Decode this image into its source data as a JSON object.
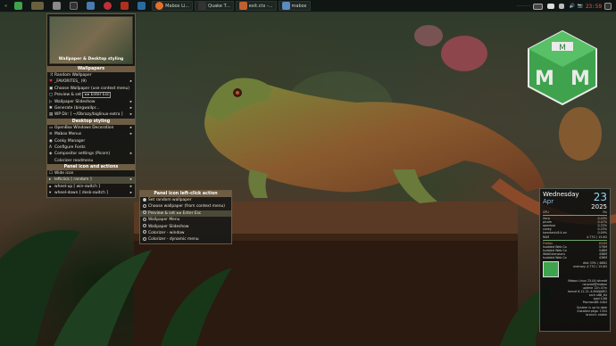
{
  "panel": {
    "tasks": [
      "Mabox Li...",
      "Quake T...",
      "exit.ctx -...",
      "mabox"
    ],
    "clock": "23:59"
  },
  "menu": {
    "thumb_caption": "Wallpaper & Desktop styling",
    "sections": {
      "wallpapers": "Wallpapers",
      "desktop": "Desktop styling",
      "panel_icon": "Panel icon and actions"
    },
    "items": [
      {
        "label": "Random Wallpaper",
        "arrow": ""
      },
      {
        "label": "_FAVORITES_",
        "extra": "(9)",
        "arrow": "▸"
      },
      {
        "label": "Choose Wallpaper (use context menu)",
        "arrow": ""
      },
      {
        "label": "Preview & set",
        "extra": "◂ ▸ Enter Esc",
        "arrow": ""
      },
      {
        "label": "Wallpaper Slideshow",
        "arrow": "▸"
      },
      {
        "label": "Generate (bingwallpr...",
        "arrow": "▸"
      },
      {
        "label": "WP Dir: [ ~/Obrazy/biglinux-extra ]",
        "arrow": "▸"
      }
    ],
    "desktop_items": [
      {
        "label": "OpenBox Windows Decoration",
        "arrow": "▸"
      },
      {
        "label": "Mabox Menus",
        "arrow": "▸"
      },
      {
        "label": "Conky Manager",
        "arrow": ""
      },
      {
        "label": "Configure Fonts",
        "arrow": ""
      },
      {
        "label": "Compositor settings (Picom)",
        "arrow": "▸"
      },
      {
        "label": "Colorizer readmenu",
        "arrow": ""
      }
    ],
    "panel_items": [
      {
        "label": "Wide icon",
        "arrow": ""
      },
      {
        "label": "leftclick [ random ]",
        "arrow": "▸"
      },
      {
        "label": "wheel-up [ win-switch ]",
        "arrow": "▸"
      },
      {
        "label": "wheel-down [ desk-switch ]",
        "arrow": "▸"
      }
    ]
  },
  "submenu": {
    "title": "Panel icon left-click action",
    "items": [
      {
        "label": "Set random wallpaper",
        "on": true
      },
      {
        "label": "Choose wallpaper (from context menu)",
        "on": false
      },
      {
        "label": "Preview & set  ◂ ▸ Enter Esc",
        "on": false
      },
      {
        "label": "Wallpaper Menu",
        "on": false
      },
      {
        "label": "Wallpaper Slideshow",
        "on": false
      },
      {
        "label": "Colorizer - window",
        "on": false
      },
      {
        "label": "Colorizer - dynamic menu",
        "on": false
      }
    ]
  },
  "conky": {
    "weekday": "Wednesday",
    "day": "23",
    "month": "Apr",
    "year": "2025",
    "cpu_label": "CPU",
    "cpu_value": "3%",
    "procs": [
      [
        "Xorg",
        "0.43%"
      ],
      [
        "picom",
        "0.47%"
      ],
      [
        "openbox",
        "0.33%"
      ],
      [
        "conky",
        "0.25%"
      ],
      [
        "kworker/u8:4-ev",
        "0.09%"
      ]
    ],
    "ram_label": "RAM",
    "ram_value": "4.77G / 15.6G",
    "mem": [
      [
        "Firefox",
        "854M"
      ],
      [
        "Isolated Web Co",
        "579M"
      ],
      [
        "Isolated Web Co",
        "548M"
      ],
      [
        "WebExtensions",
        "456M"
      ],
      [
        "Isolated Web Co",
        "436M"
      ]
    ],
    "disk": "disk 33%  /  468G",
    "memory": "memory 4.77G / 15.6G",
    "sys": [
      "Mabox Linux 25.04 Istredd",
      "neucold@mabox",
      "uptime 12h 47m",
      "kernel 6.12.21-4-MANJARO",
      "arch x86_64",
      "load 0.88",
      "PacmanDB 4404"
    ],
    "footer": [
      "System is up to date",
      "Installed pkgs: 1354",
      "branch: stable"
    ]
  }
}
